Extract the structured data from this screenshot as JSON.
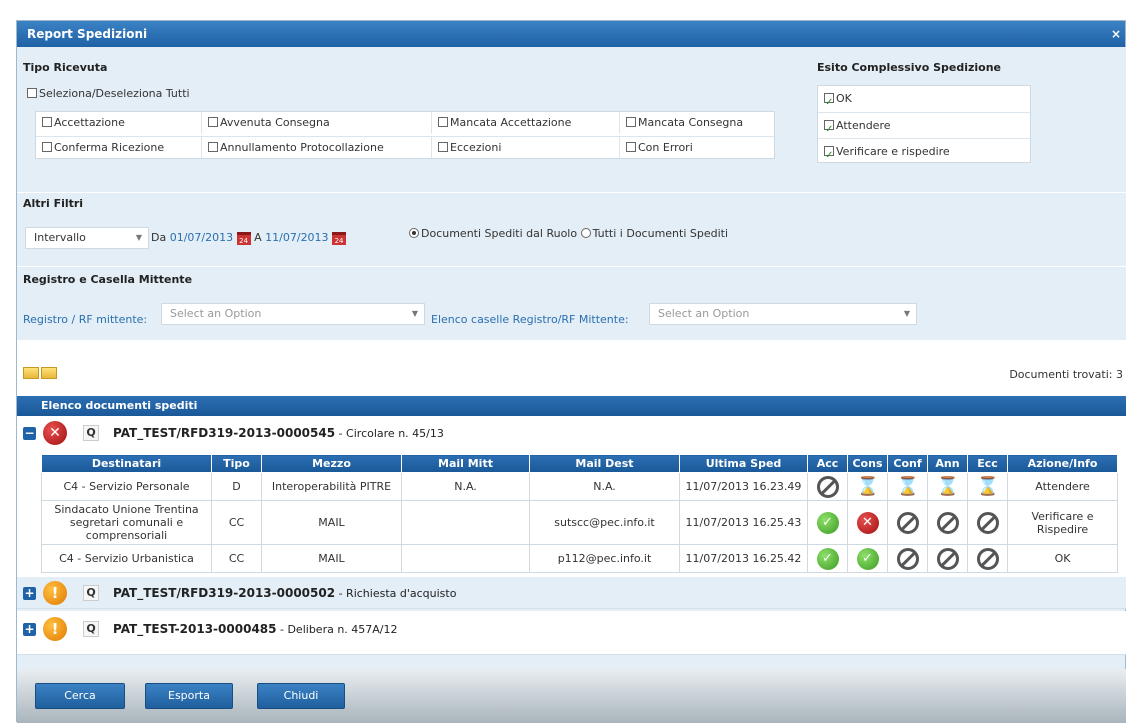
{
  "dialog": {
    "title": "Report Spedizioni",
    "close": "×"
  },
  "tipo_ricevuta": {
    "title": "Tipo Ricevuta",
    "select_all": "Seleziona/Deseleziona Tutti",
    "row1": [
      "Accettazione",
      "Avvenuta Consegna",
      "Mancata Accettazione",
      "Mancata Consegna"
    ],
    "row2": [
      "Conferma Ricezione",
      "Annullamento Protocollazione",
      "Eccezioni",
      "Con Errori"
    ]
  },
  "esito": {
    "title": "Esito Complessivo Spedizione",
    "items": [
      "OK",
      "Attendere",
      "Verificare e rispedire"
    ]
  },
  "altri_filtri": {
    "title": "Altri Filtri",
    "intervallo": "Intervallo",
    "da_label": "Da",
    "da_value": "01/07/2013",
    "a_label": "A",
    "a_value": "11/07/2013",
    "cal_day": "24",
    "radio1": "Documenti Spediti dal Ruolo",
    "radio2": "Tutti i Documenti Spediti"
  },
  "registro": {
    "title": "Registro e Casella Mittente",
    "label1": "Registro / RF mittente:",
    "placeholder1": "Select an Option",
    "label2": "Elenco caselle Registro/RF Mittente:",
    "placeholder2": "Select an Option"
  },
  "toolbar": {
    "found": "Documenti trovati: 3"
  },
  "docs": {
    "header": "Elenco documenti spediti",
    "d1": {
      "pm": "−",
      "status": "✕",
      "mag": "Q",
      "id": "PAT_TEST/RFD319-2013-0000545",
      "desc": " - Circolare n. 45/13"
    },
    "d2": {
      "pm": "+",
      "status": "!",
      "mag": "Q",
      "id": "PAT_TEST/RFD319-2013-0000502",
      "desc": " - Richiesta d'acquisto"
    },
    "d3": {
      "pm": "+",
      "status": "!",
      "mag": "Q",
      "id": "PAT_TEST-2013-0000485",
      "desc": " - Delibera n. 457A/12"
    }
  },
  "table": {
    "headers": [
      "Destinatari",
      "Tipo",
      "Mezzo",
      "Mail Mitt",
      "Mail Dest",
      "Ultima Sped",
      "Acc",
      "Cons",
      "Conf",
      "Ann",
      "Ecc",
      "Azione/Info"
    ],
    "rows": [
      {
        "dest": "C4 - Servizio Personale",
        "tipo": "D",
        "mezzo": "Interoperabilità PITRE",
        "mitt": "N.A.",
        "mdest": "N.A.",
        "sped": "11/07/2013 16.23.49",
        "status": [
          "no",
          "hourglass",
          "hourglass",
          "hourglass",
          "hourglass"
        ],
        "azione": "Attendere"
      },
      {
        "dest": "Sindacato Unione Trentina segretari comunali e comprensoriali",
        "tipo": "CC",
        "mezzo": "MAIL",
        "mitt": "",
        "mdest": "sutscc@pec.info.it",
        "sped": "11/07/2013 16.25.43",
        "status": [
          "ok",
          "error",
          "no",
          "no",
          "no"
        ],
        "azione": "Verificare e Rispedire"
      },
      {
        "dest": "C4 - Servizio Urbanistica",
        "tipo": "CC",
        "mezzo": "MAIL",
        "mitt": "",
        "mdest": "p112@pec.info.it",
        "sped": "11/07/2013 16.25.42",
        "status": [
          "ok",
          "ok",
          "no",
          "no",
          "no"
        ],
        "azione": "OK"
      }
    ]
  },
  "footer": {
    "cerca": "Cerca",
    "esporta": "Esporta",
    "chiudi": "Chiudi"
  }
}
